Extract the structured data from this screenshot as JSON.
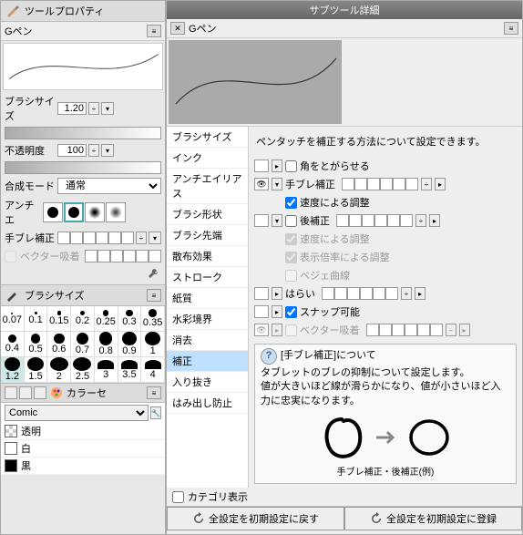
{
  "left": {
    "tool_prop_title": "ツールプロパティ",
    "gpen": "Gペン",
    "brush_size_label": "ブラシサイズ",
    "brush_size_value": "1.20",
    "opacity_label": "不透明度",
    "opacity_value": "100",
    "blend_label": "合成モード",
    "blend_value": "通常",
    "aa_label": "アンチエ",
    "stabilize_label": "手ブレ補正",
    "vector_snap": "ベクター吸着",
    "brush_size_header": "ブラシサイズ",
    "sizes": [
      "0.07",
      "0.1",
      "0.15",
      "0.2",
      "0.25",
      "0.3",
      "0.35",
      "0.4",
      "0.5",
      "0.6",
      "0.7",
      "0.8",
      "0.9",
      "1",
      "1.2",
      "1.5",
      "2",
      "2.5",
      "3",
      "3.5",
      "4"
    ],
    "size_selected_index": 14,
    "color_set_title": "カラーセ",
    "comic_label": "Comic",
    "colors": [
      {
        "name": "透明",
        "type": "trans"
      },
      {
        "name": "白",
        "type": "white"
      },
      {
        "name": "黒",
        "type": "black"
      }
    ]
  },
  "right": {
    "title": "サブツール詳細",
    "gpen": "Gペン",
    "categories": [
      "ブラシサイズ",
      "インク",
      "アンチエイリアス",
      "ブラシ形状",
      "ブラシ先端",
      "散布効果",
      "ストローク",
      "紙質",
      "水彩境界",
      "消去",
      "補正",
      "入り抜き",
      "はみ出し防止"
    ],
    "selected_cat_index": 10,
    "desc": "ペンタッチを補正する方法について設定できます。",
    "rows": {
      "sharp_corner": "角をとがらせる",
      "stabilize": "手ブレ補正",
      "speed_adjust": "速度による調整",
      "post": "後補正",
      "speed_adjust2": "速度による調整",
      "zoom_adjust": "表示倍率による調整",
      "bezier": "ベジェ曲線",
      "sweep": "はらい",
      "snap": "スナップ可能",
      "vector": "ベクター吸着"
    },
    "info": {
      "title": "[手ブレ補正]について",
      "body1": "タブレットのブレの抑制について設定します。",
      "body2": "値が大きいほど線が滑らかになり、値が小さいほど入力に忠実になります。",
      "caption": "手ブレ補正・後補正(例)"
    },
    "category_show": "カテゴリ表示",
    "footer": {
      "reset": "全設定を初期設定に戻す",
      "register": "全設定を初期設定に登録"
    }
  }
}
